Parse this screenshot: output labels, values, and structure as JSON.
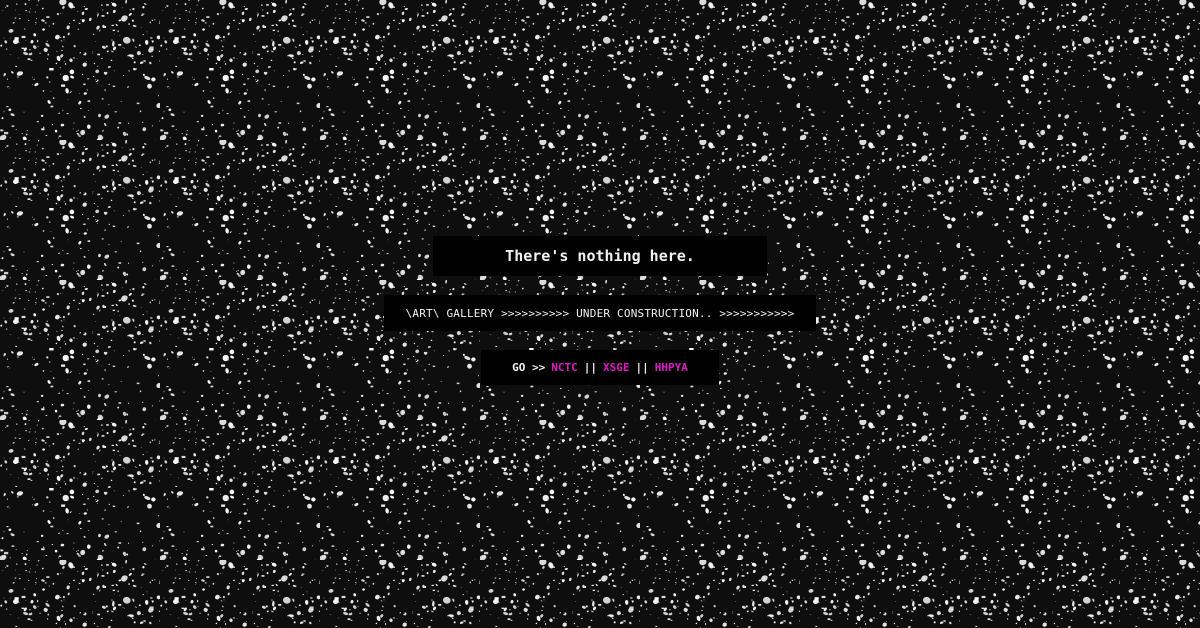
{
  "colors": {
    "background": "#0e0e0e",
    "panel": "#000000",
    "text": "#f2f2f2",
    "link": "#e316c9"
  },
  "title": "There's nothing here.",
  "status": "\\ART\\ GALLERY >>>>>>>>>> UNDER CONSTRUCTION.. >>>>>>>>>>>",
  "nav": {
    "prefix": "GO >>",
    "separator": "||",
    "links": [
      "NCTC",
      "XSGE",
      "HHPYA"
    ]
  }
}
